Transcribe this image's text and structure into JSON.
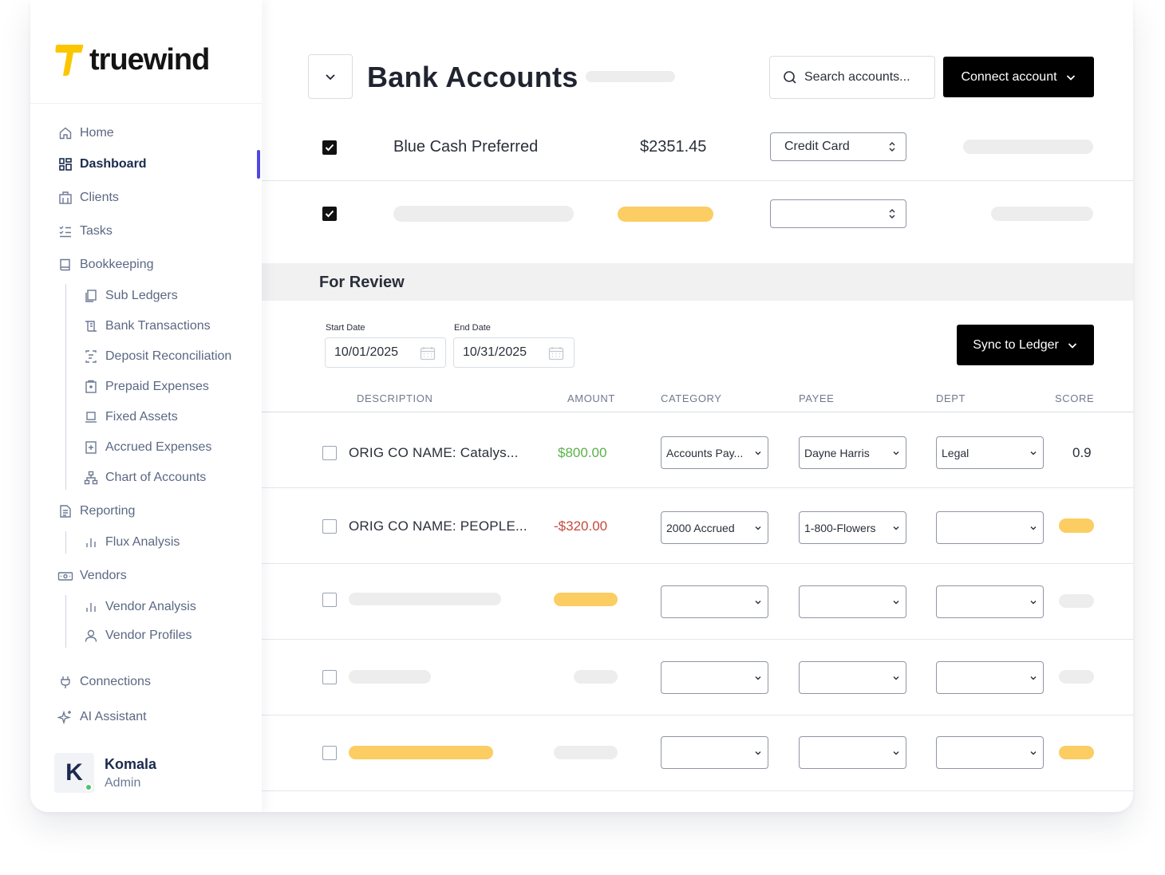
{
  "brand": {
    "name": "truewind",
    "logo_color": "#fbc600"
  },
  "sidebar": {
    "items": [
      {
        "label": "Home",
        "icon": "home-icon"
      },
      {
        "label": "Dashboard",
        "icon": "dashboard-icon",
        "active": true
      },
      {
        "label": "Clients",
        "icon": "building-icon"
      },
      {
        "label": "Tasks",
        "icon": "tasks-icon"
      },
      {
        "label": "Bookkeeping",
        "icon": "book-icon",
        "children": [
          {
            "label": "Sub Ledgers",
            "icon": "copy-icon"
          },
          {
            "label": "Bank Transactions",
            "icon": "receipt-icon"
          },
          {
            "label": "Deposit Reconciliation",
            "icon": "reconcile-icon"
          },
          {
            "label": "Prepaid Expenses",
            "icon": "prepaid-icon"
          },
          {
            "label": "Fixed Assets",
            "icon": "laptop-icon"
          },
          {
            "label": "Accrued Expenses",
            "icon": "plus-doc-icon"
          },
          {
            "label": "Chart of Accounts",
            "icon": "hierarchy-icon"
          }
        ]
      },
      {
        "label": "Reporting",
        "icon": "report-icon",
        "children": [
          {
            "label": "Flux Analysis",
            "icon": "bar-chart-icon"
          }
        ]
      },
      {
        "label": "Vendors",
        "icon": "cash-icon",
        "children": [
          {
            "label": "Vendor Analysis",
            "icon": "bar-chart-icon"
          },
          {
            "label": "Vendor Profiles",
            "icon": "user-icon"
          }
        ]
      },
      {
        "label": "Connections",
        "icon": "plug-icon"
      },
      {
        "label": "AI Assistant",
        "icon": "sparkle-icon"
      }
    ],
    "user": {
      "initial": "K",
      "name": "Komala",
      "role": "Admin",
      "status_color": "#4bc46b"
    }
  },
  "header": {
    "title": "Bank Accounts",
    "search_placeholder": "Search accounts...",
    "connect_label": "Connect account"
  },
  "accounts": [
    {
      "name": "Blue Cash Preferred",
      "amount": "$2351.45",
      "type": "Credit Card",
      "checked": true
    },
    {
      "name": "",
      "amount": "",
      "type": "",
      "checked": true
    }
  ],
  "review": {
    "title": "For Review",
    "start_label": "Start Date",
    "start_value": "10/01/2025",
    "end_label": "End Date",
    "end_value": "10/31/2025",
    "sync_label": "Sync to Ledger",
    "columns": [
      "DESCRIPTION",
      "AMOUNT",
      "CATEGORY",
      "PAYEE",
      "DEPT",
      "SCORE"
    ],
    "rows": [
      {
        "description": "ORIG CO NAME: Catalys...",
        "amount": "$800.00",
        "category": "Accounts Pay...",
        "payee": "Dayne Harris",
        "dept": "Legal",
        "score": "0.9"
      },
      {
        "description": "ORIG CO NAME: PEOPLE...",
        "amount": "-$320.00",
        "category": "2000 Accrued",
        "payee": "1-800-Flowers",
        "dept": "",
        "score": ""
      },
      {
        "description": "",
        "amount": "",
        "category": "",
        "payee": "",
        "dept": "",
        "score": ""
      },
      {
        "description": "",
        "amount": "",
        "category": "",
        "payee": "",
        "dept": "",
        "score": ""
      },
      {
        "description": "",
        "amount": "",
        "category": "",
        "payee": "",
        "dept": "",
        "score": ""
      }
    ]
  },
  "colors": {
    "accent": "#4f46e5",
    "placeholder_yellow": "#fbcd63",
    "placeholder_gray": "#ededee",
    "positive": "#5ab14a",
    "negative": "#c44a3c"
  }
}
